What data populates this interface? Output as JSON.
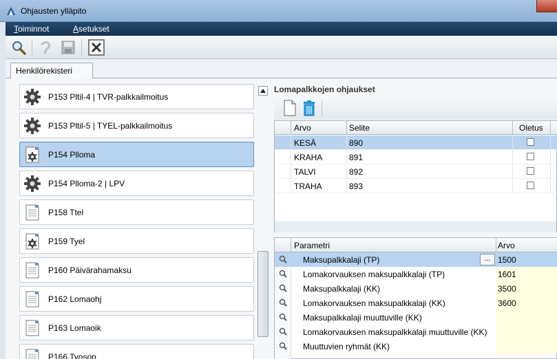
{
  "window": {
    "title": "Ohjausten ylläpito"
  },
  "menu": [
    {
      "accel": "T",
      "rest": "oiminnot"
    },
    {
      "accel": "A",
      "rest": "setukset"
    }
  ],
  "toolbar": {
    "icons": [
      "search-icon",
      "undo-icon",
      "save-icon",
      "close-icon"
    ]
  },
  "tabs": [
    {
      "label": "Henkilörekisteri"
    }
  ],
  "left_list": [
    {
      "label": "P153 Pltil-4 | TVR-palkkailmoitus",
      "icon": "gear-icon"
    },
    {
      "label": "P153 Pltil-5 | TYEL-palkkailmoitus",
      "icon": "gear-icon"
    },
    {
      "label": "P154 Plloma",
      "icon": "document-gear-icon",
      "selected": true
    },
    {
      "label": "P154 Plloma-2 | LPV",
      "icon": "gear-icon"
    },
    {
      "label": "P158 Ttel",
      "icon": "document-icon"
    },
    {
      "label": "P159 Tyel",
      "icon": "document-gear-icon"
    },
    {
      "label": "P160 Päivärahamaksu",
      "icon": "document-icon"
    },
    {
      "label": "P162 Lomaohj",
      "icon": "document-icon"
    },
    {
      "label": "P163 Lomaoik",
      "icon": "document-icon"
    },
    {
      "label": "P166 Tyosop",
      "icon": "document-icon"
    }
  ],
  "right": {
    "title": "Lomapalkkojen ohjaukset",
    "grid1": {
      "headers": {
        "arvo": "Arvo",
        "selite": "Selite",
        "oletus": "Oletus"
      },
      "rows": [
        {
          "arvo": "KESÄ",
          "selite": "890",
          "oletus": false,
          "selected": true
        },
        {
          "arvo": "KRAHA",
          "selite": "891",
          "oletus": false
        },
        {
          "arvo": "TALVI",
          "selite": "892",
          "oletus": false
        },
        {
          "arvo": "TRAHA",
          "selite": "893",
          "oletus": false
        }
      ]
    },
    "grid2": {
      "headers": {
        "parametri": "Parametri",
        "arvo": "Arvo"
      },
      "ellipsis": "...",
      "rows": [
        {
          "parametri": "Maksupalkkalaji (TP)",
          "arvo": "1500",
          "selected": true
        },
        {
          "parametri": "Lomakorvauksen maksupalkkalaji (TP)",
          "arvo": "1601"
        },
        {
          "parametri": "Maksupalkkalaji (KK)",
          "arvo": "3500"
        },
        {
          "parametri": "Lomakorvauksen maksupalkkalaji (KK)",
          "arvo": "3600"
        },
        {
          "parametri": "Maksupalkkalaji muuttuville (KK)",
          "arvo": ""
        },
        {
          "parametri": "Lomakorvauksen maksupalkkalaji muuttuville (KK)",
          "arvo": ""
        },
        {
          "parametri": "Muuttuvien ryhmät (KK)",
          "arvo": ""
        }
      ]
    }
  }
}
